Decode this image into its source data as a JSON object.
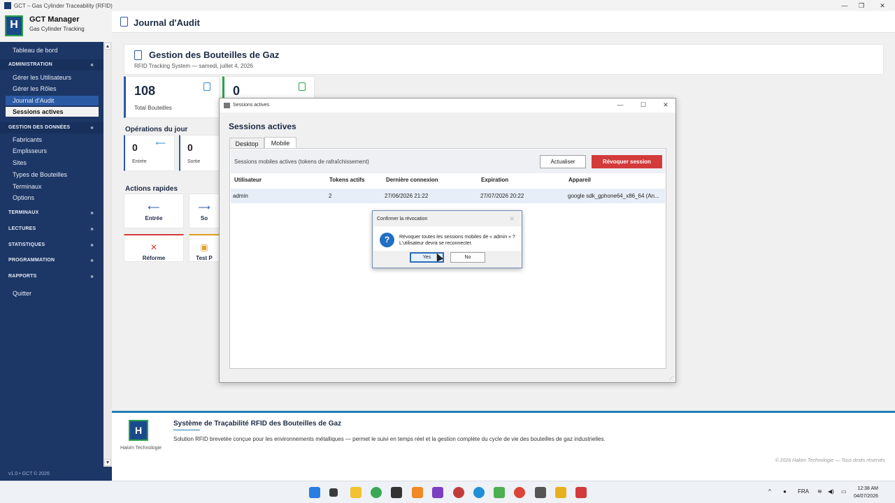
{
  "window": {
    "title": "GCT – Gas Cylinder Traceability (RFID)"
  },
  "brand": {
    "name": "GCT Manager",
    "subtitle": "Gas Cylinder Tracking",
    "logo_letter": "H"
  },
  "sidebar": {
    "dashboard": "Tableau de bord",
    "sections": [
      {
        "label": "ADMINISTRATION",
        "chevron": "«",
        "items": [
          "Gérer les Utilisateurs",
          "Gérer les Rôles",
          "Journal d'Audit",
          "Sessions actives"
        ]
      },
      {
        "label": "GESTION DES DONNÉES",
        "chevron": "«",
        "items": [
          "Fabricants",
          "Emplisseurs",
          "Sites",
          "Types de Bouteilles",
          "Terminaux",
          "Options"
        ]
      },
      {
        "label": "TERMINAUX",
        "chevron": "»"
      },
      {
        "label": "LECTURES",
        "chevron": "»"
      },
      {
        "label": "STATISTIQUES",
        "chevron": "»"
      },
      {
        "label": "PROGRAMMATION",
        "chevron": "»"
      },
      {
        "label": "RAPPORTS",
        "chevron": "»"
      }
    ],
    "quit": "Quitter",
    "version": "v1.0  •  GCT © 2026"
  },
  "header": {
    "title": "Journal d'Audit"
  },
  "main": {
    "title": "Gestion des Bouteilles de Gaz",
    "subtitle": "RFID Tracking System  —  samedi, juillet 4, 2026",
    "stats": [
      {
        "value": "108",
        "label": "Total Bouteilles"
      },
      {
        "value": "0",
        "label": ""
      }
    ],
    "ops_title": "Opérations du jour",
    "ops": [
      {
        "value": "0",
        "label": "Entrée",
        "arrow": "⟵"
      },
      {
        "value": "0",
        "label": "Sortie",
        "arrow": ""
      }
    ],
    "quick_title": "Actions rapides",
    "quick": [
      {
        "label": "Entrée",
        "glyph": "⟵"
      },
      {
        "label": "So",
        "glyph": "⟶"
      },
      {
        "label": "Réforme",
        "glyph": "✕"
      },
      {
        "label": "Test P",
        "glyph": "▣"
      }
    ]
  },
  "sessions_dialog": {
    "title": "Sessions actives",
    "heading": "Sessions actives",
    "tabs": [
      "Desktop",
      "Mobile"
    ],
    "description": "Sessions mobiles actives (tokens de rafraîchissement)",
    "refresh_label": "Actualiser",
    "revoke_label": "Révoquer session",
    "columns": [
      "Utilisateur",
      "Tokens actifs",
      "Dernière connexion",
      "Expiration",
      "Appareil"
    ],
    "rows": [
      [
        "admin",
        "2",
        "27/06/2026 21:22",
        "27/07/2026 20:22",
        "google sdk_gphone64_x86_64 (An..."
      ]
    ]
  },
  "confirm_dialog": {
    "title": "Confirmer la révocation",
    "line1": "Révoquer toutes les sessions mobiles de « admin » ?",
    "line2": "L'utilisateur devra se reconnecter.",
    "yes": "Yes",
    "no": "No"
  },
  "footer": {
    "title": "Système de Traçabilité RFID des Bouteilles de Gaz",
    "description": "Solution RFID brevetée conçue pour les environnements métalliques — permet le suivi en temps réel et la gestion complète du cycle de vie des bouteilles de gaz industrielles.",
    "company": "Hakim Technologie",
    "copyright": "© 2026 Hakim Technologie — Tous droits réservés"
  },
  "taskbar": {
    "language": "FRA",
    "time": "12:38 AM",
    "date": "04/07/2026"
  }
}
